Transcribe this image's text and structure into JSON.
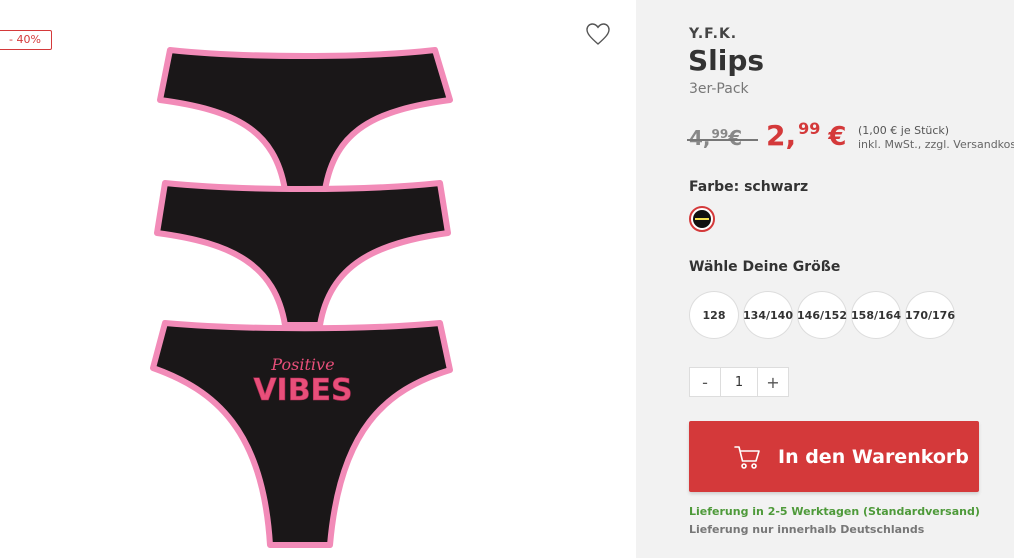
{
  "product": {
    "discount_badge": "- 40%",
    "brand": "Y.F.K.",
    "title": "Slips",
    "subtitle": "3er-Pack",
    "image_print_line1": "Positive",
    "image_print_line2": "VIBES"
  },
  "price": {
    "old_main": "4,",
    "old_cents": "99",
    "old_currency": "€",
    "new_main": "2,",
    "new_cents": "99",
    "new_currency": "€",
    "unit_price": "(1,00 € je Stück)",
    "tax_note": "inkl. MwSt., zzgl. Versandkosten"
  },
  "color": {
    "label": "Farbe: schwarz",
    "selected": "schwarz"
  },
  "sizes": {
    "label": "Wähle Deine Größe",
    "options": [
      "128",
      "134/140",
      "146/152",
      "158/164",
      "170/176"
    ]
  },
  "quantity": {
    "minus": "-",
    "value": "1",
    "plus": "+"
  },
  "cart": {
    "label": "In den Warenkorb"
  },
  "delivery": {
    "primary": "Lieferung in 2-5 Werktagen (Standardversand)",
    "secondary": "Lieferung nur innerhalb Deutschlands"
  },
  "colors": {
    "accent": "#d4393a",
    "delivery_green": "#4e9a3a",
    "trim_pink": "#f28bb8"
  },
  "icons": {
    "wishlist": "heart-icon",
    "cart": "shopping-cart-icon"
  }
}
